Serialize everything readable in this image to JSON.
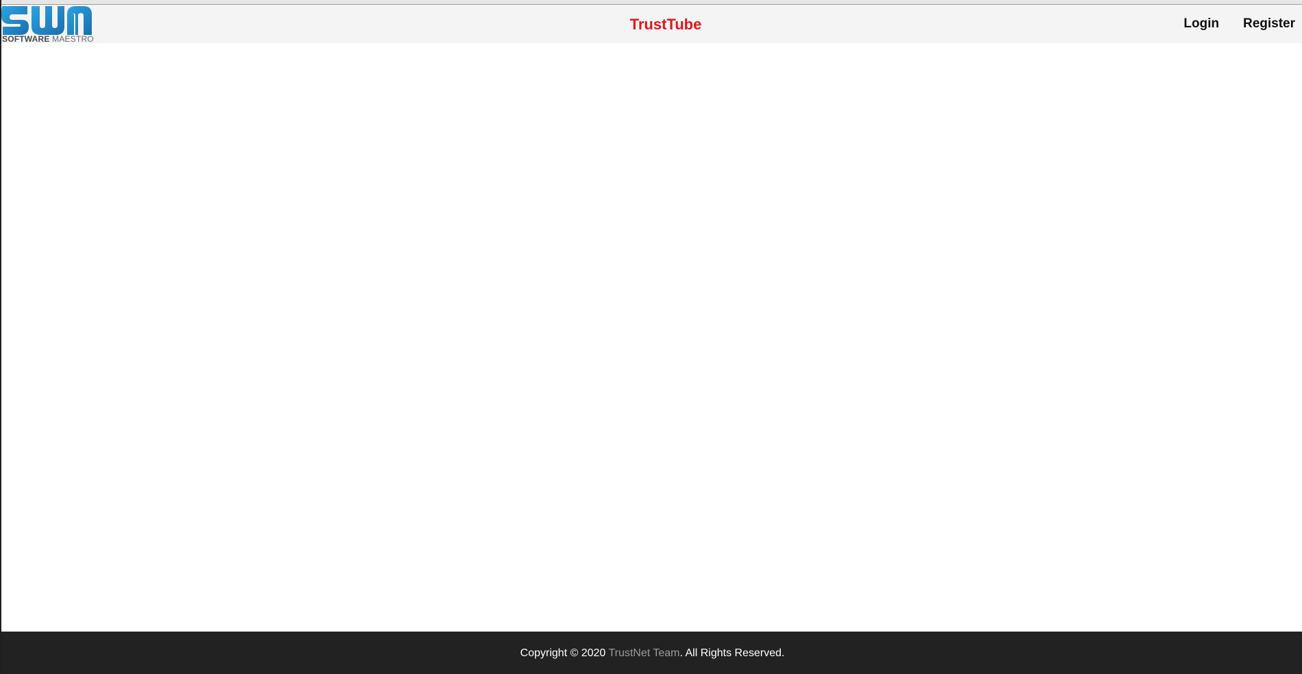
{
  "header": {
    "logo": {
      "icon": "swm-logo-icon",
      "caption_bold": "SOFTWARE",
      "caption_regular": "MAESTRO",
      "colors": {
        "primary": "#1d86c8",
        "secondary": "#2ba3e0",
        "caption": "#6a6a6a"
      }
    },
    "title": "TrustTube",
    "title_color": "#e8141b",
    "nav": {
      "login": "Login",
      "register": "Register"
    }
  },
  "footer": {
    "prefix": "Copyright © 2020 ",
    "team": "TrustNet Team",
    "suffix": ". All Rights Reserved.",
    "background": "#222222"
  }
}
